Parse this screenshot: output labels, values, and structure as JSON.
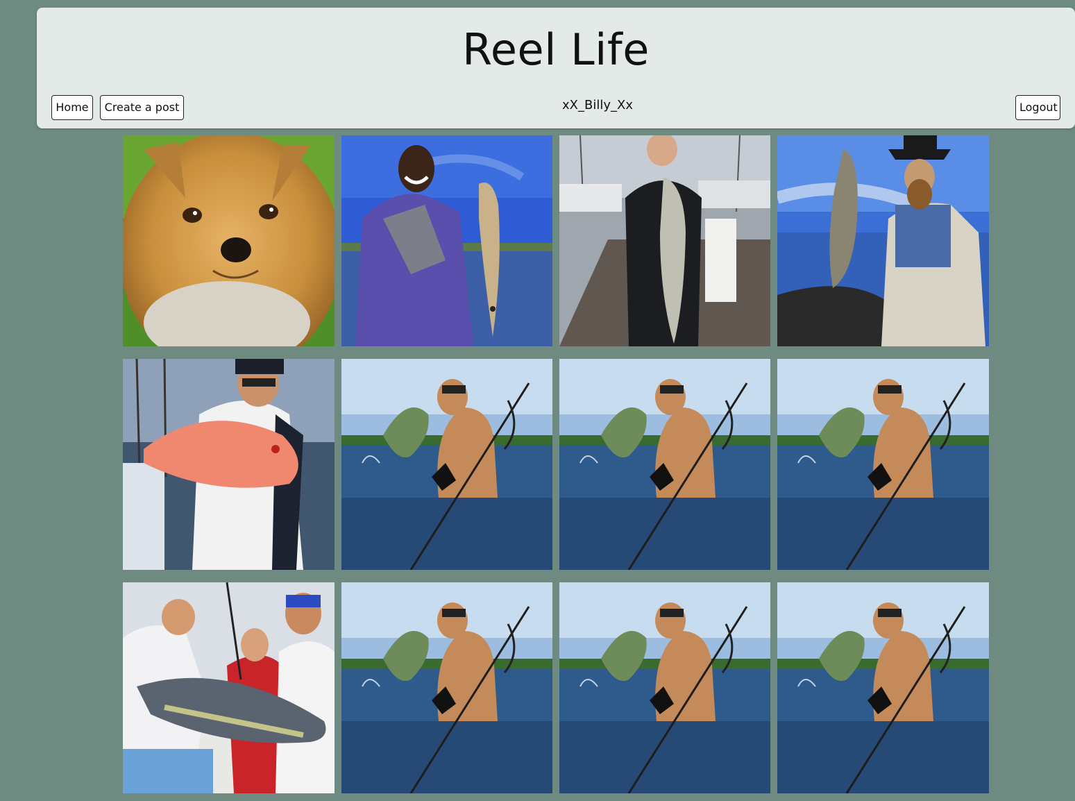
{
  "header": {
    "title": "Reel Life",
    "username": "xX_Billy_Xx",
    "nav": {
      "home_label": "Home",
      "create_label": "Create a post",
      "logout_label": "Logout"
    }
  },
  "colors": {
    "page_background": "#6f8a80",
    "header_background": "#e4eae8",
    "button_border": "#222222"
  },
  "posts": [
    {
      "image": "yorkshire-terrier-photo"
    },
    {
      "image": "man-holding-redfish-photo"
    },
    {
      "image": "man-holding-striped-bass-at-marina-photo"
    },
    {
      "image": "bearded-man-holding-catfish-on-boat-photo"
    },
    {
      "image": "man-holding-red-snapper-photo"
    },
    {
      "image": "spearfisher-holding-fish-in-water-photo"
    },
    {
      "image": "spearfisher-holding-fish-in-water-photo"
    },
    {
      "image": "spearfisher-holding-fish-in-water-photo"
    },
    {
      "image": "three-men-holding-tuna-photo"
    },
    {
      "image": "spearfisher-holding-fish-in-water-photo"
    },
    {
      "image": "spearfisher-holding-fish-in-water-photo"
    },
    {
      "image": "spearfisher-holding-fish-in-water-photo"
    }
  ]
}
